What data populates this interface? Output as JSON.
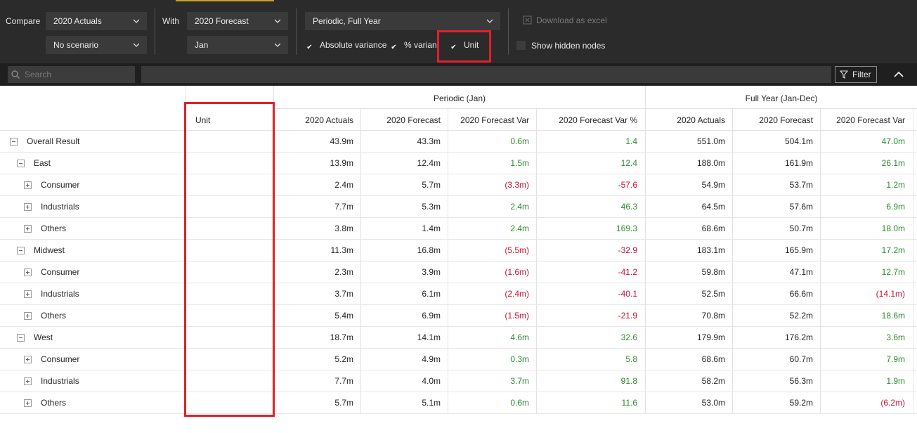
{
  "toolbar": {
    "compare_label": "Compare",
    "compare_value": "2020 Actuals",
    "scenario_value": "No scenario",
    "with_label": "With",
    "with_value": "2020 Forecast",
    "month_value": "Jan",
    "period_value": "Periodic, Full Year",
    "abs_variance_label": "Absolute variance",
    "pct_variance_label": "% varianc",
    "unit_label": "Unit",
    "download_label": "Download as excel",
    "hidden_nodes_label": "Show hidden nodes",
    "checkbox_check": "✔"
  },
  "search": {
    "placeholder": "Search",
    "filter_label": "Filter"
  },
  "grid": {
    "group_periodic": "Periodic (Jan)",
    "group_fullyear": "Full Year (Jan-Dec)",
    "unit_header": "Unit",
    "columns": [
      "2020 Actuals",
      "2020 Forecast",
      "2020 Forecast Var",
      "2020 Forecast Var %",
      "2020 Actuals",
      "2020 Forecast",
      "2020 Forecast Var"
    ],
    "rows": [
      {
        "label": "Overall Result",
        "level": 0,
        "toggle": "minus",
        "values": [
          "43.9m",
          "43.3m",
          "0.6m",
          "1.4",
          "551.0m",
          "504.1m",
          "47.0m"
        ],
        "signs": [
          "",
          "",
          "pos",
          "pos",
          "",
          "",
          "pos"
        ]
      },
      {
        "label": "East",
        "level": 1,
        "toggle": "minus",
        "values": [
          "13.9m",
          "12.4m",
          "1.5m",
          "12.4",
          "188.0m",
          "161.9m",
          "26.1m"
        ],
        "signs": [
          "",
          "",
          "pos",
          "pos",
          "",
          "",
          "pos"
        ]
      },
      {
        "label": "Consumer",
        "level": 2,
        "toggle": "plus",
        "values": [
          "2.4m",
          "5.7m",
          "(3.3m)",
          "-57.6",
          "54.9m",
          "53.7m",
          "1.2m"
        ],
        "signs": [
          "",
          "",
          "neg",
          "neg",
          "",
          "",
          "pos"
        ]
      },
      {
        "label": "Industrials",
        "level": 2,
        "toggle": "plus",
        "values": [
          "7.7m",
          "5.3m",
          "2.4m",
          "46.3",
          "64.5m",
          "57.6m",
          "6.9m"
        ],
        "signs": [
          "",
          "",
          "pos",
          "pos",
          "",
          "",
          "pos"
        ]
      },
      {
        "label": "Others",
        "level": 2,
        "toggle": "plus",
        "values": [
          "3.8m",
          "1.4m",
          "2.4m",
          "169.3",
          "68.6m",
          "50.7m",
          "18.0m"
        ],
        "signs": [
          "",
          "",
          "pos",
          "pos",
          "",
          "",
          "pos"
        ]
      },
      {
        "label": "Midwest",
        "level": 1,
        "toggle": "minus",
        "values": [
          "11.3m",
          "16.8m",
          "(5.5m)",
          "-32.9",
          "183.1m",
          "165.9m",
          "17.2m"
        ],
        "signs": [
          "",
          "",
          "neg",
          "neg",
          "",
          "",
          "pos"
        ]
      },
      {
        "label": "Consumer",
        "level": 2,
        "toggle": "plus",
        "values": [
          "2.3m",
          "3.9m",
          "(1.6m)",
          "-41.2",
          "59.8m",
          "47.1m",
          "12.7m"
        ],
        "signs": [
          "",
          "",
          "neg",
          "neg",
          "",
          "",
          "pos"
        ]
      },
      {
        "label": "Industrials",
        "level": 2,
        "toggle": "plus",
        "values": [
          "3.7m",
          "6.1m",
          "(2.4m)",
          "-40.1",
          "52.5m",
          "66.6m",
          "(14.1m)"
        ],
        "signs": [
          "",
          "",
          "neg",
          "neg",
          "",
          "",
          "neg"
        ]
      },
      {
        "label": "Others",
        "level": 2,
        "toggle": "plus",
        "values": [
          "5.4m",
          "6.9m",
          "(1.5m)",
          "-21.9",
          "70.8m",
          "52.2m",
          "18.6m"
        ],
        "signs": [
          "",
          "",
          "neg",
          "neg",
          "",
          "",
          "pos"
        ]
      },
      {
        "label": "West",
        "level": 1,
        "toggle": "minus",
        "values": [
          "18.7m",
          "14.1m",
          "4.6m",
          "32.6",
          "179.9m",
          "176.2m",
          "3.6m"
        ],
        "signs": [
          "",
          "",
          "pos",
          "pos",
          "",
          "",
          "pos"
        ]
      },
      {
        "label": "Consumer",
        "level": 2,
        "toggle": "plus",
        "values": [
          "5.2m",
          "4.9m",
          "0.3m",
          "5.8",
          "68.6m",
          "60.7m",
          "7.9m"
        ],
        "signs": [
          "",
          "",
          "pos",
          "pos",
          "",
          "",
          "pos"
        ]
      },
      {
        "label": "Industrials",
        "level": 2,
        "toggle": "plus",
        "values": [
          "7.7m",
          "4.0m",
          "3.7m",
          "91.8",
          "58.2m",
          "56.3m",
          "1.9m"
        ],
        "signs": [
          "",
          "",
          "pos",
          "pos",
          "",
          "",
          "pos"
        ]
      },
      {
        "label": "Others",
        "level": 2,
        "toggle": "plus",
        "values": [
          "5.7m",
          "5.1m",
          "0.6m",
          "11.6",
          "53.0m",
          "59.2m",
          "(6.2m)"
        ],
        "signs": [
          "",
          "",
          "pos",
          "pos",
          "",
          "",
          "neg"
        ]
      }
    ]
  },
  "colors": {
    "toolbar_bg": "#2b2b2b",
    "positive": "#2e8b2e",
    "negative": "#c8102e",
    "highlight": "#e3202a"
  }
}
